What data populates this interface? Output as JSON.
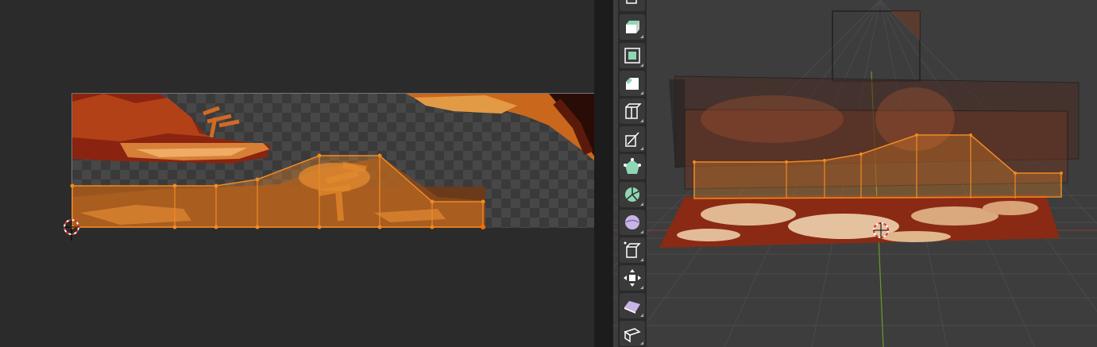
{
  "uv_editor": {
    "image_name": ""
  },
  "viewport": {
    "mode": ""
  },
  "toolbar": {
    "tools": [
      {
        "name": "tool-box-icon",
        "color": "#8fd6b4"
      },
      {
        "name": "tool-extrude-region-icon",
        "color": "#8fd6b4"
      },
      {
        "name": "tool-inset-faces-icon",
        "color": "#8fd6b4"
      },
      {
        "name": "tool-bevel-icon",
        "color": "#ffffff"
      },
      {
        "name": "tool-loop-cut-icon",
        "color": "#ffffff"
      },
      {
        "name": "tool-knife-icon",
        "color": "#ffffff"
      },
      {
        "name": "tool-poly-build-icon",
        "color": "#8fd6b4"
      },
      {
        "name": "tool-spin-icon",
        "color": "#8fd6b4"
      },
      {
        "name": "tool-smooth-icon",
        "color": "#c8b4e6"
      },
      {
        "name": "tool-edge-slide-icon",
        "color": "#ffffff"
      },
      {
        "name": "tool-shrink-fatten-icon",
        "color": "#ffffff"
      },
      {
        "name": "tool-shear-icon",
        "color": "#c8b4e6"
      },
      {
        "name": "tool-rip-region-icon",
        "color": "#ffffff"
      }
    ]
  },
  "colors": {
    "selection": "#f08a24",
    "active_vertex": "#ff6a00",
    "background": "#2b2b2b",
    "viewport_bg": "#3d3d3d"
  }
}
